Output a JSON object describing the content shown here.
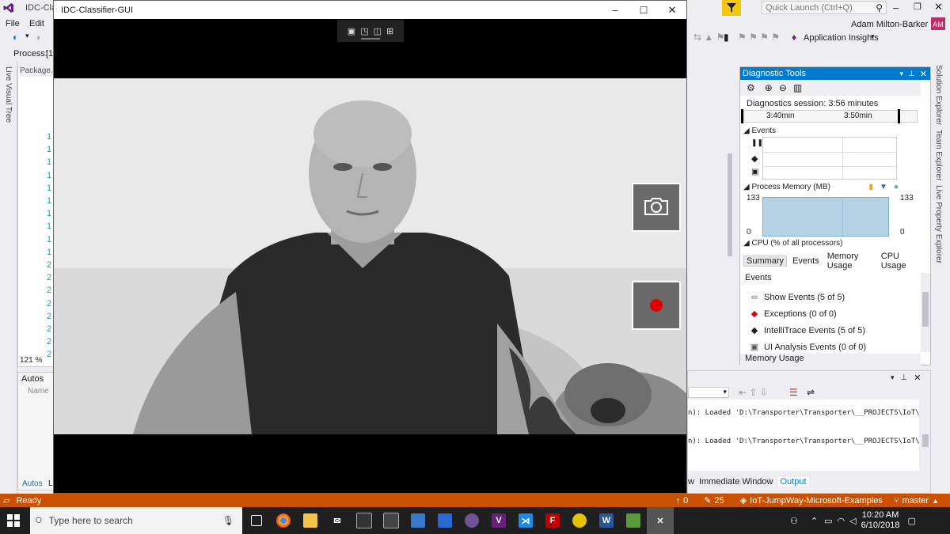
{
  "vs": {
    "window_title": "IDC-Cla",
    "quick_launch_placeholder": "Quick Launch (Ctrl+Q)",
    "user_name": "Adam Milton-Barker",
    "user_initials": "AM",
    "menu": [
      "File",
      "Edit"
    ],
    "app_insights": "Application Insights",
    "process_label": "Process:",
    "process_value": "[1",
    "editor_tab": "Package.a",
    "zoom": "121 %",
    "left_sidebar_label": "Live Visual Tree",
    "right_sidebar": [
      "Solution Explorer",
      "Team Explorer",
      "Live Property Explorer"
    ],
    "autos": {
      "title": "Autos",
      "column": "Name",
      "tab1": "Autos",
      "tab2": "Lo"
    },
    "line_numbers": [
      "1",
      "1",
      "1",
      "1",
      "1",
      "1",
      "1",
      "1",
      "1",
      "1",
      "2",
      "2",
      "2",
      "2",
      "2",
      "2",
      "2",
      "2"
    ]
  },
  "diagnostics": {
    "title": "Diagnostic Tools",
    "session": "Diagnostics session: 3:56 minutes",
    "timeline_labels": [
      "3:40min",
      "3:50min"
    ],
    "events_label": "Events",
    "memory_label": "Process Memory (MB)",
    "memory_max": "133",
    "memory_min": "0",
    "cpu_label": "CPU (% of all processors)",
    "tabs": [
      "Summary",
      "Events",
      "Memory Usage",
      "CPU Usage"
    ],
    "events_header": "Events",
    "event_items": [
      {
        "label": "Show Events (5 of 5)",
        "icon": "link-icon"
      },
      {
        "label": "Exceptions (0 of 0)",
        "icon": "red-diamond-icon"
      },
      {
        "label": "IntelliTrace Events (5 of 5)",
        "icon": "black-diamond-icon"
      },
      {
        "label": "UI Analysis Events (0 of 0)",
        "icon": "ui-analysis-icon"
      }
    ],
    "memory_usage_header": "Memory Usage"
  },
  "output": {
    "lines": [
      "n): Loaded 'D:\\Transporter\\Transporter\\__PROJECTS\\IoT\\_GIT",
      "n): Loaded 'D:\\Transporter\\Transporter\\__PROJECTS\\IoT\\_GIT"
    ],
    "tabs": [
      "w",
      "Immediate Window",
      "Output"
    ]
  },
  "statusbar": {
    "status": "Ready",
    "up_count": "0",
    "edit_count": "25",
    "repo": "IoT-JumpWay-Microsoft-Examples",
    "branch": "master"
  },
  "taskbar": {
    "search_placeholder": "Type here to search",
    "time": "10:20 AM",
    "date": "6/10/2018"
  },
  "app": {
    "title": "IDC-Classifier-GUI"
  },
  "colors": {
    "vs_accent": "#007acc",
    "status_bar": "#ca5100",
    "record_dot": "#e00000"
  }
}
